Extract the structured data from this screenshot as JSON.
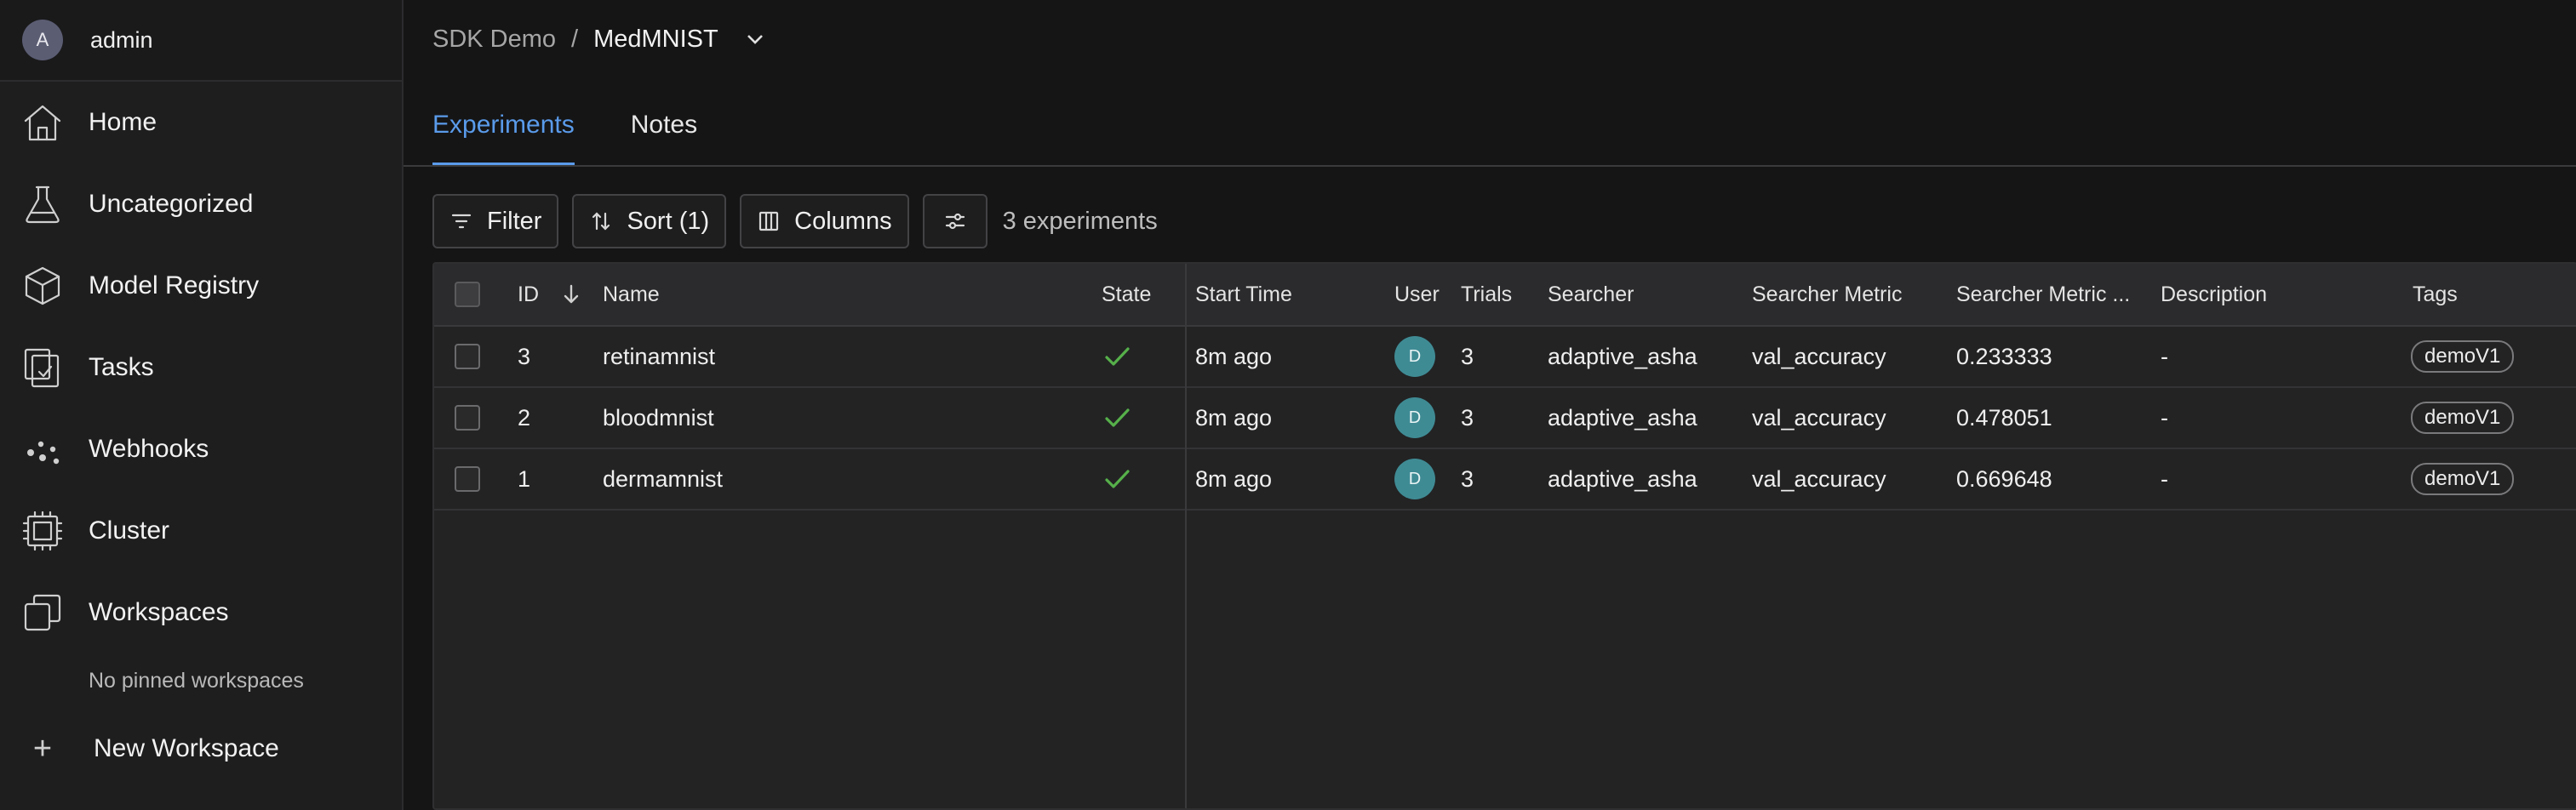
{
  "sidebar": {
    "user": {
      "initial": "A",
      "name": "admin"
    },
    "items": [
      {
        "label": "Home",
        "icon": "home-icon"
      },
      {
        "label": "Uncategorized",
        "icon": "flask-icon"
      },
      {
        "label": "Model Registry",
        "icon": "cube-icon"
      },
      {
        "label": "Tasks",
        "icon": "tasks-icon"
      },
      {
        "label": "Webhooks",
        "icon": "webhooks-icon"
      },
      {
        "label": "Cluster",
        "icon": "chip-icon"
      },
      {
        "label": "Workspaces",
        "icon": "workspaces-icon"
      }
    ],
    "no_pinned": "No pinned workspaces",
    "new_workspace": "New Workspace"
  },
  "breadcrumb": {
    "parent": "SDK Demo",
    "separator": "/",
    "current": "MedMNIST"
  },
  "tabs": [
    {
      "label": "Experiments",
      "active": true
    },
    {
      "label": "Notes",
      "active": false
    }
  ],
  "toolbar": {
    "filter": "Filter",
    "sort": "Sort (1)",
    "columns": "Columns",
    "count": "3 experiments"
  },
  "table": {
    "columns": [
      "ID",
      "Name",
      "State",
      "Start Time",
      "User",
      "Trials",
      "Searcher",
      "Searcher Metric",
      "Searcher Metric ...",
      "Description",
      "Tags"
    ],
    "rows": [
      {
        "id": "3",
        "name": "retinamnist",
        "state": "completed",
        "start_time": "8m ago",
        "user": "D",
        "trials": "3",
        "searcher": "adaptive_asha",
        "metric": "val_accuracy",
        "metric_value": "0.233333",
        "description": "-",
        "tag": "demoV1"
      },
      {
        "id": "2",
        "name": "bloodmnist",
        "state": "completed",
        "start_time": "8m ago",
        "user": "D",
        "trials": "3",
        "searcher": "adaptive_asha",
        "metric": "val_accuracy",
        "metric_value": "0.478051",
        "description": "-",
        "tag": "demoV1"
      },
      {
        "id": "1",
        "name": "dermamnist",
        "state": "completed",
        "start_time": "8m ago",
        "user": "D",
        "trials": "3",
        "searcher": "adaptive_asha",
        "metric": "val_accuracy",
        "metric_value": "0.669648",
        "description": "-",
        "tag": "demoV1"
      }
    ]
  },
  "colors": {
    "accent": "#5a9bea",
    "success": "#56b04a",
    "user_avatar": "#3f8b94"
  }
}
